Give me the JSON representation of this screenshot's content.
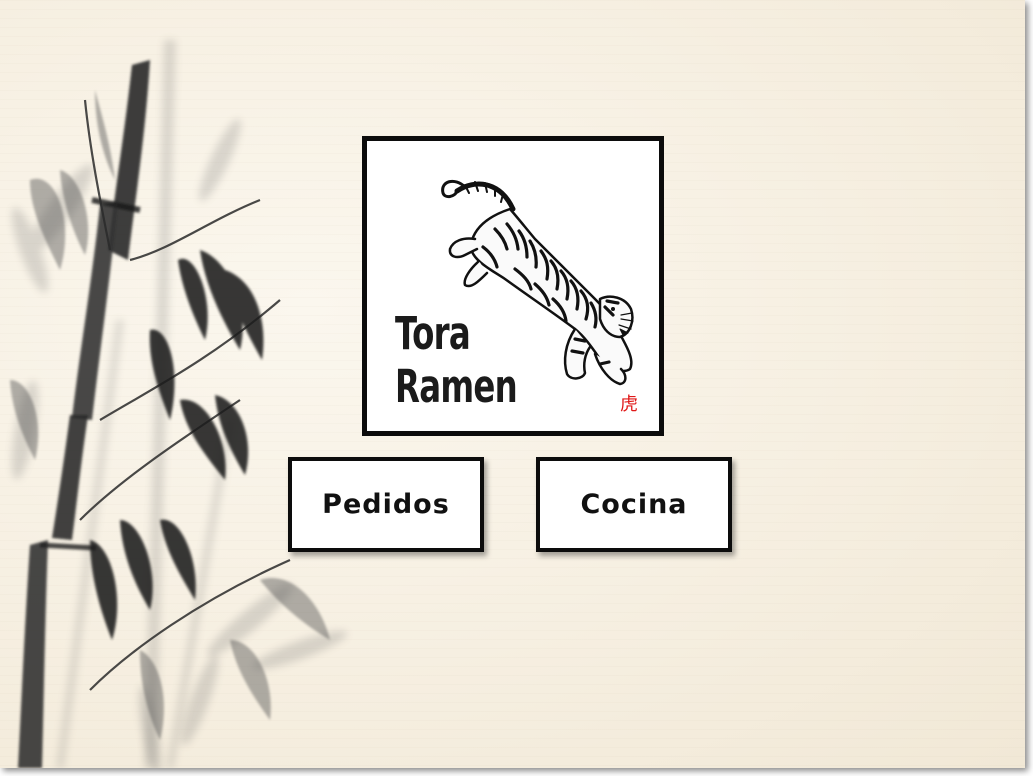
{
  "logo": {
    "line1": "Tora",
    "line2": "Ramen",
    "seal": "虎",
    "seal_color": "#e01818",
    "image": "tiger-illustration"
  },
  "buttons": {
    "orders_label": "Pedidos",
    "kitchen_label": "Cocina"
  },
  "background": {
    "image": "ink-bamboo-painting",
    "paper_color": "#f6efe1"
  }
}
